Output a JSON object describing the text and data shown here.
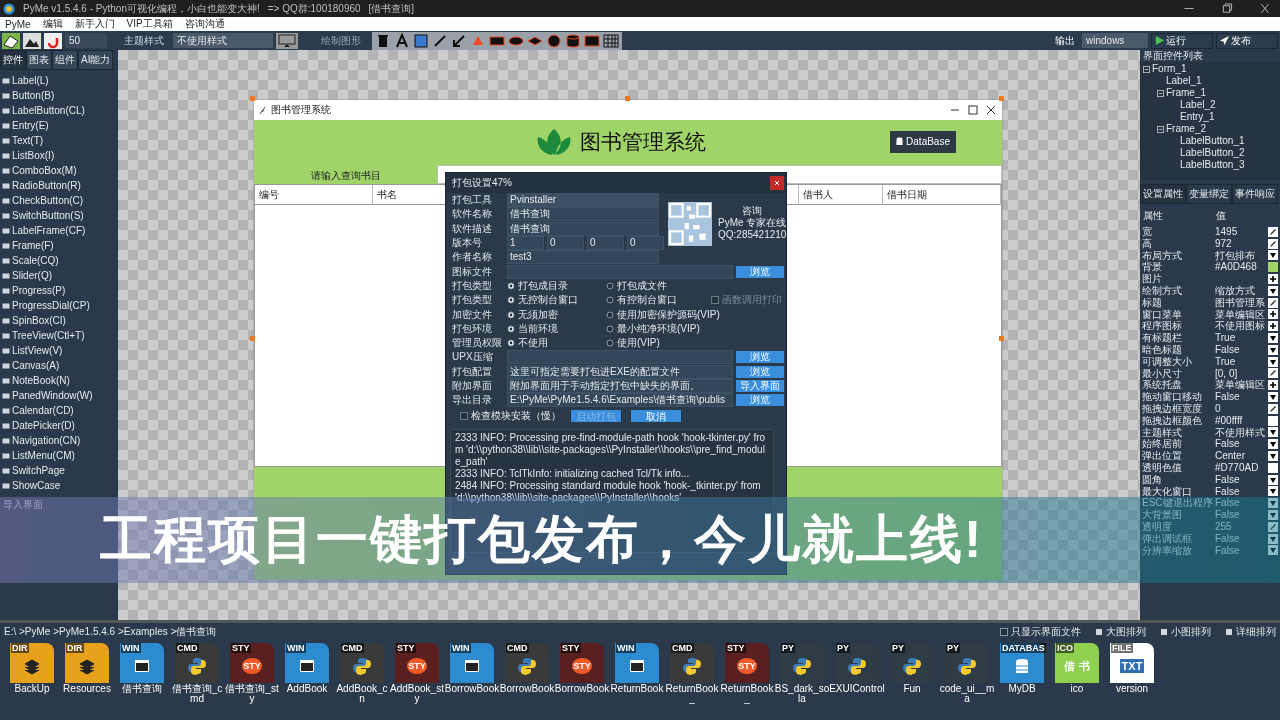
{
  "window": {
    "title_parts": [
      "PyMe v1.5.4.6 - Python可视化编程，小白也能变大神!",
      "=> QQ群:100180960",
      "[借书查询]"
    ]
  },
  "menu": [
    "PyMe",
    "编辑",
    "新手入门",
    "VIP工具箱",
    "咨询沟通"
  ],
  "toolbar": {
    "size_value": "50",
    "theme_label": "主题样式",
    "theme_value": "不使用样式",
    "draw_label": "绘制图形",
    "output_label": "输出",
    "output_value": "windows",
    "run_label": "运行",
    "publish_label": "发布"
  },
  "palette": {
    "tabs": [
      {
        "label": "控件",
        "selected": true
      },
      {
        "label": "图表",
        "selected": false
      },
      {
        "label": "组件",
        "selected": false
      },
      {
        "label": "AI能力",
        "selected": false
      }
    ],
    "items": [
      "Label(L)",
      "Button(B)",
      "LabelButton(CL)",
      "Entry(E)",
      "Text(T)",
      "ListBox(I)",
      "ComboBox(M)",
      "RadioButton(R)",
      "CheckButton(C)",
      "SwitchButton(S)",
      "LabelFrame(CF)",
      "Frame(F)",
      "Scale(CQ)",
      "Slider(Q)",
      "Progress(P)",
      "ProgressDial(CP)",
      "SpinBox(CI)",
      "TreeView(Ctl+T)",
      "ListView(V)",
      "Canvas(A)",
      "NoteBook(N)",
      "PanedWindow(W)",
      "Calendar(CD)",
      "DatePicker(D)",
      "Navigation(CN)",
      "ListMenu(CM)",
      "SwitchPage",
      "ShowCase"
    ],
    "import_label": "导入界面"
  },
  "form": {
    "title": "图书管理系统",
    "header_title": "图书管理系统",
    "db_button": "DataBase",
    "search_label": "请输入查询书目",
    "columns": [
      "编号",
      "书名",
      "借书人",
      "借书日期"
    ]
  },
  "dialog": {
    "title": "打包设置47%",
    "fields": [
      {
        "kind": "combo",
        "label": "打包工具",
        "value": "Pvinstaller"
      },
      {
        "kind": "text",
        "label": "软件名称",
        "value": "借书查询"
      },
      {
        "kind": "text",
        "label": "软件描述",
        "value": "借书查询"
      },
      {
        "kind": "version",
        "label": "版本号",
        "parts": [
          "1",
          "0",
          "0",
          "0"
        ]
      },
      {
        "kind": "text",
        "label": "作者名称",
        "value": "test3"
      }
    ],
    "qr": {
      "lines": [
        "咨询",
        "PyMe 专家在线",
        "QQ:285421210"
      ]
    },
    "icon_row": {
      "label": "图标文件",
      "button": "浏览"
    },
    "radio_rows": [
      {
        "label": "打包类型",
        "options": [
          {
            "label": "打包成目录",
            "selected": true
          },
          {
            "label": "打包成文件",
            "selected": false
          }
        ]
      },
      {
        "label": "打包类型",
        "options": [
          {
            "label": "无控制台窗口",
            "selected": true
          },
          {
            "label": "有控制台窗口",
            "selected": false
          }
        ],
        "extra": {
          "label": "函数调用打印",
          "checked": false,
          "disabled": true
        }
      },
      {
        "label": "加密文件",
        "options": [
          {
            "label": "无须加密",
            "selected": true
          },
          {
            "label": "使用加密保护源码(VIP)",
            "selected": false
          }
        ]
      },
      {
        "label": "打包环境",
        "options": [
          {
            "label": "当前环境",
            "selected": true
          },
          {
            "label": "最小纯净环境(VIP)",
            "selected": false
          }
        ]
      },
      {
        "label": "管理员权限",
        "options": [
          {
            "label": "不使用",
            "selected": true
          },
          {
            "label": "使用(VIP)",
            "selected": false
          }
        ]
      }
    ],
    "path_rows": [
      {
        "label": "UPX压缩",
        "button": "浏览"
      },
      {
        "label": "打包配置",
        "value": "这里可指定需要打包进EXE的配置文件",
        "button": "浏览"
      },
      {
        "label": "附加界面",
        "value": "附加界面用于手动指定打包中缺失的界面。",
        "button": "导入界面"
      },
      {
        "label": "导出目录",
        "value": "E:\\PyMe\\PyMe1.5.4.6\\Examples\\借书查询\\publis",
        "button": "浏览"
      }
    ],
    "check": {
      "label": "检查模块安装（慢）",
      "checked": false
    },
    "start_button": {
      "label": "启动打包",
      "disabled": true
    },
    "cancel_button": "取消",
    "log": [
      "2333 INFO: Processing pre-find-module-path hook 'hook-tkinter.py' from 'd:\\\\python38\\\\lib\\\\site-packages\\\\PyInstaller\\\\hooks\\\\pre_find_module_path'",
      "2333 INFO: TclTkInfo: initializing cached Tcl/Tk info...",
      "2484 INFO: Processing standard module hook 'hook-_tkinter.py' from 'd:\\\\python38\\\\lib\\\\site-packages\\\\PyInstaller\\\\hooks'"
    ]
  },
  "banner": "工程项目一键打包发布，今儿就上线!",
  "right": {
    "tree_title": "界面控件列表",
    "tree": [
      {
        "label": "Form_1",
        "expanded": true,
        "children": [
          {
            "label": "Label_1"
          },
          {
            "label": "Frame_1",
            "expanded": true,
            "children": [
              {
                "label": "Label_2"
              },
              {
                "label": "Entry_1"
              }
            ]
          },
          {
            "label": "Frame_2",
            "expanded": true,
            "children": [
              {
                "label": "LabelButton_1"
              },
              {
                "label": "LabelButton_2"
              },
              {
                "label": "LabelButton_3"
              }
            ]
          }
        ]
      }
    ],
    "tabs": [
      {
        "label": "设置属性",
        "selected": true
      },
      {
        "label": "变量绑定",
        "selected": false
      },
      {
        "label": "事件响应",
        "selected": false
      }
    ],
    "head": [
      "属性",
      "值"
    ],
    "props": [
      {
        "name": "宽",
        "value": "1495",
        "kind": "edit"
      },
      {
        "name": "高",
        "value": "972",
        "kind": "edit"
      },
      {
        "name": "布局方式",
        "value": "打包排布",
        "kind": "drop"
      },
      {
        "name": "背景",
        "value": "#A0D468",
        "kind": "swatch",
        "color": "#a0d468"
      },
      {
        "name": "图片",
        "kind": "add"
      },
      {
        "name": "绘制方式",
        "value": "缩放方式",
        "kind": "drop"
      },
      {
        "name": "标题",
        "value": "图书管理系",
        "kind": "edit"
      },
      {
        "name": "窗口菜单",
        "value": "菜单编辑区",
        "kind": "add"
      },
      {
        "name": "程序图标",
        "value": "不使用图标",
        "kind": "add"
      },
      {
        "name": "有标题栏",
        "value": "True",
        "kind": "drop"
      },
      {
        "name": "暗色标题",
        "value": "False",
        "kind": "drop"
      },
      {
        "name": "可调整大小",
        "value": "True",
        "kind": "drop"
      },
      {
        "name": "最小尺寸",
        "value": "[0, 0]",
        "kind": "edit"
      },
      {
        "name": "系统托盘",
        "value": "菜单编辑区",
        "kind": "add"
      },
      {
        "name": "拖动窗口移动",
        "value": "False",
        "kind": "drop"
      },
      {
        "name": "拖拽边框宽度",
        "value": "0",
        "kind": "edit"
      },
      {
        "name": "拖拽边框颜色",
        "value": "#00ffff",
        "kind": "swatch",
        "color": "#ffffff"
      },
      {
        "name": "主题样式",
        "value": "不使用样式",
        "kind": "drop"
      },
      {
        "name": "始终居前",
        "value": "False",
        "kind": "drop"
      },
      {
        "name": "弹出位置",
        "value": "Center",
        "kind": "drop"
      },
      {
        "name": "透明色值",
        "value": "#D770AD",
        "kind": "swatch",
        "color": "#ffffff"
      },
      {
        "name": "圆角",
        "value": "False",
        "kind": "drop"
      },
      {
        "name": "最大化窗口",
        "value": "False",
        "kind": "drop"
      },
      {
        "name": "ESC键退出程序",
        "value": "False",
        "kind": "drop"
      },
      {
        "name": "大背景图",
        "value": "False",
        "kind": "drop"
      },
      {
        "name": "透明度",
        "value": "255",
        "kind": "edit"
      },
      {
        "name": "弹出调试框",
        "value": "False",
        "kind": "drop"
      },
      {
        "name": "分辨率缩放",
        "value": "False",
        "kind": "drop"
      }
    ]
  },
  "files": {
    "path": "E:\\ >PyMe >PyMe1.5.4.6 >Examples >借书查询",
    "only_ui": {
      "label": "只显示界面文件",
      "checked": false
    },
    "views": [
      "大图排列",
      "小图排列",
      "详细排列"
    ],
    "items": [
      {
        "kind": "dir",
        "tag": "DIR",
        "name": "BackUp"
      },
      {
        "kind": "dir",
        "tag": "DIR",
        "name": "Resources"
      },
      {
        "kind": "win",
        "tag": "WIN",
        "name": "借书查询"
      },
      {
        "kind": "cmd",
        "tag": "CMD",
        "name": "借书查询_cmd"
      },
      {
        "kind": "sty",
        "tag": "STY",
        "glyph": "STY",
        "name": "借书查询_sty"
      },
      {
        "kind": "win",
        "tag": "WIN",
        "name": "AddBook"
      },
      {
        "kind": "cmd",
        "tag": "CMD",
        "name": "AddBook_cn"
      },
      {
        "kind": "sty",
        "tag": "STY",
        "glyph": "STY",
        "name": "AddBook_sty"
      },
      {
        "kind": "win",
        "tag": "WIN",
        "name": "BorrowBook"
      },
      {
        "kind": "cmd",
        "tag": "CMD",
        "name": "BorrowBook"
      },
      {
        "kind": "sty",
        "tag": "STY",
        "glyph": "STY",
        "name": "BorrowBook"
      },
      {
        "kind": "win",
        "tag": "WIN",
        "name": "ReturnBook"
      },
      {
        "kind": "cmd",
        "tag": "CMD",
        "name": "ReturnBook_"
      },
      {
        "kind": "sty",
        "tag": "STY",
        "glyph": "STY",
        "name": "ReturnBook_"
      },
      {
        "kind": "py",
        "tag": "PY",
        "name": "BS_dark_sola"
      },
      {
        "kind": "py",
        "tag": "PY",
        "name": "EXUIControl"
      },
      {
        "kind": "py",
        "tag": "PY",
        "name": "Fun"
      },
      {
        "kind": "py",
        "tag": "PY",
        "name": "code_ui__ma"
      },
      {
        "kind": "db",
        "tag": "DATABAS",
        "name": "MyDB"
      },
      {
        "kind": "ico",
        "tag": "ICO",
        "glyph": "借 书",
        "name": "ico"
      },
      {
        "kind": "file",
        "tag": "FILE",
        "glyph": "TXT",
        "name": "version"
      }
    ]
  }
}
